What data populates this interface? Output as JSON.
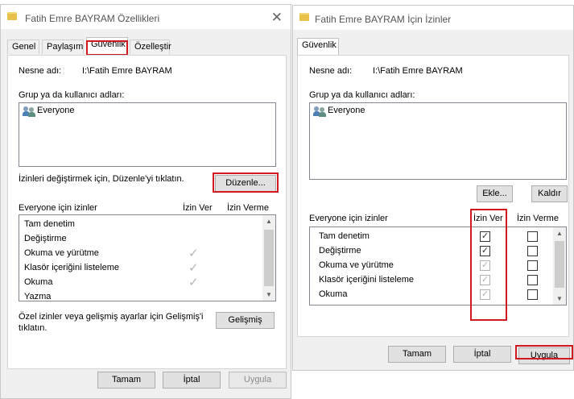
{
  "props": {
    "title": "Fatih Emre BAYRAM Özellikleri",
    "tabs": [
      "Genel",
      "Paylaşım",
      "Güvenlik",
      "Özelleştir"
    ],
    "object_label": "Nesne adı:",
    "object_value": "I:\\Fatih Emre BAYRAM",
    "groups_label": "Grup ya da kullanıcı adları:",
    "group": "Everyone",
    "edit_hint": "İzinleri değiştirmek için, Düzenle'yi tıklatın.",
    "edit_button": "Düzenle...",
    "perm_label": "Everyone için izinler",
    "allow_col": "İzin Ver",
    "deny_col": "İzin Verme",
    "permissions": [
      "Tam denetim",
      "Değiştirme",
      "Okuma ve yürütme",
      "Klasör içeriğini listeleme",
      "Okuma",
      "Yazma"
    ],
    "advanced_hint_1": "Özel izinler veya gelişmiş ayarlar için Gelişmiş'i",
    "advanced_hint_2": "tıklatın.",
    "advanced_button": "Gelişmiş",
    "ok": "Tamam",
    "cancel": "İptal",
    "apply": "Uygula"
  },
  "perms": {
    "title": "Fatih Emre BAYRAM İçin İzinler",
    "tab": "Güvenlik",
    "object_label": "Nesne adı:",
    "object_value": "I:\\Fatih Emre BAYRAM",
    "groups_label": "Grup ya da kullanıcı adları:",
    "group": "Everyone",
    "add_button": "Ekle...",
    "remove_button": "Kaldır",
    "perm_label": "Everyone için izinler",
    "allow_col": "İzin Ver",
    "deny_col": "İzin Verme",
    "permissions": [
      "Tam denetim",
      "Değiştirme",
      "Okuma ve yürütme",
      "Klasör içeriğini listeleme",
      "Okuma"
    ],
    "ok": "Tamam",
    "cancel": "İptal",
    "apply": "Uygula"
  },
  "icons": {
    "folder": "folder-icon",
    "close": "close-icon",
    "users": "users-icon",
    "check": "check-icon"
  },
  "colors": {
    "highlight": "#d11920"
  }
}
